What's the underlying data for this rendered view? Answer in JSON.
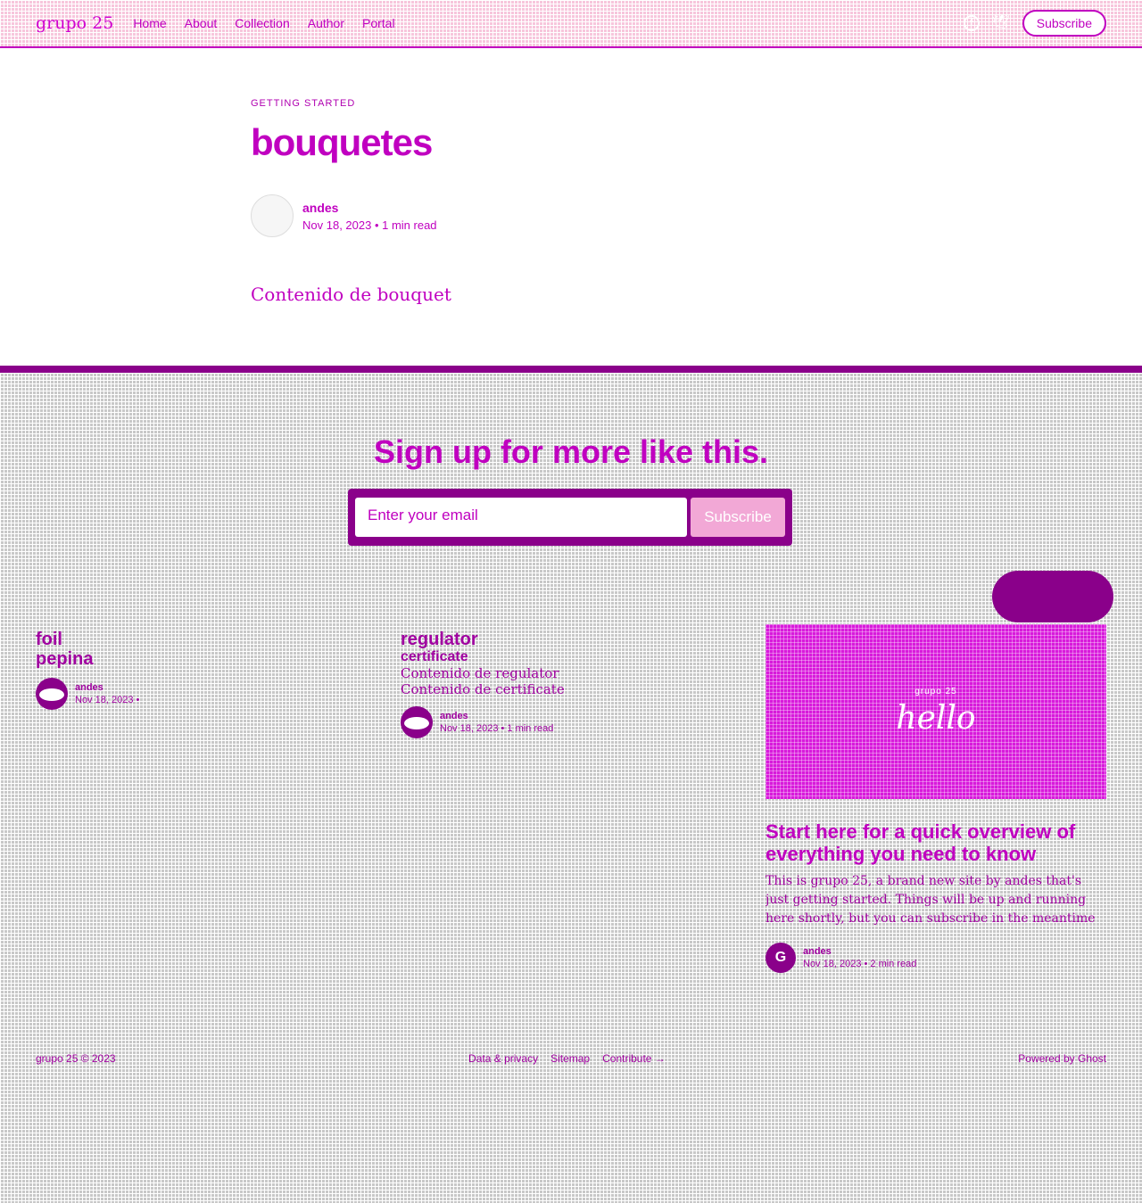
{
  "header": {
    "logo": "grupo 25",
    "nav": [
      "Home",
      "About",
      "Collection",
      "Author",
      "Portal"
    ],
    "subscribe": "Subscribe"
  },
  "article": {
    "tag": "GETTING STARTED",
    "title": "bouquetes",
    "author": "andes",
    "meta": "Nov 18, 2023 • 1 min read",
    "content": "Contenido de bouquet"
  },
  "signup": {
    "title": "Sign up for more like this.",
    "placeholder": "Enter your email",
    "button": "Subscribe"
  },
  "cards": [
    {
      "title_1": "foil",
      "title_2": "pepina",
      "author": "andes",
      "meta": "Nov 18, 2023 •"
    },
    {
      "title_1": "regulator",
      "title_2": "certificate",
      "sub_1": "Contenido de regulator",
      "sub_2": "Contenido de certificate",
      "author": "andes",
      "meta": "Nov 18, 2023 • 1 min read"
    }
  ],
  "feature": {
    "img_small": "grupo 25",
    "img_big": "hello",
    "title": "Start here for a quick overview of everything you need to know",
    "excerpt": "This is grupo 25, a brand new site by andes that's just getting started. Things will be up and running here shortly, but you can subscribe in the meantime if you'd like to stay up to date and receive emails when new content is published!",
    "author": "andes",
    "meta": "Nov 18, 2023 • 2 min read"
  },
  "footer": {
    "copyright": "grupo 25 © 2023",
    "links": [
      "Data & privacy",
      "Sitemap",
      "Contribute →"
    ],
    "powered": "Powered by Ghost"
  }
}
